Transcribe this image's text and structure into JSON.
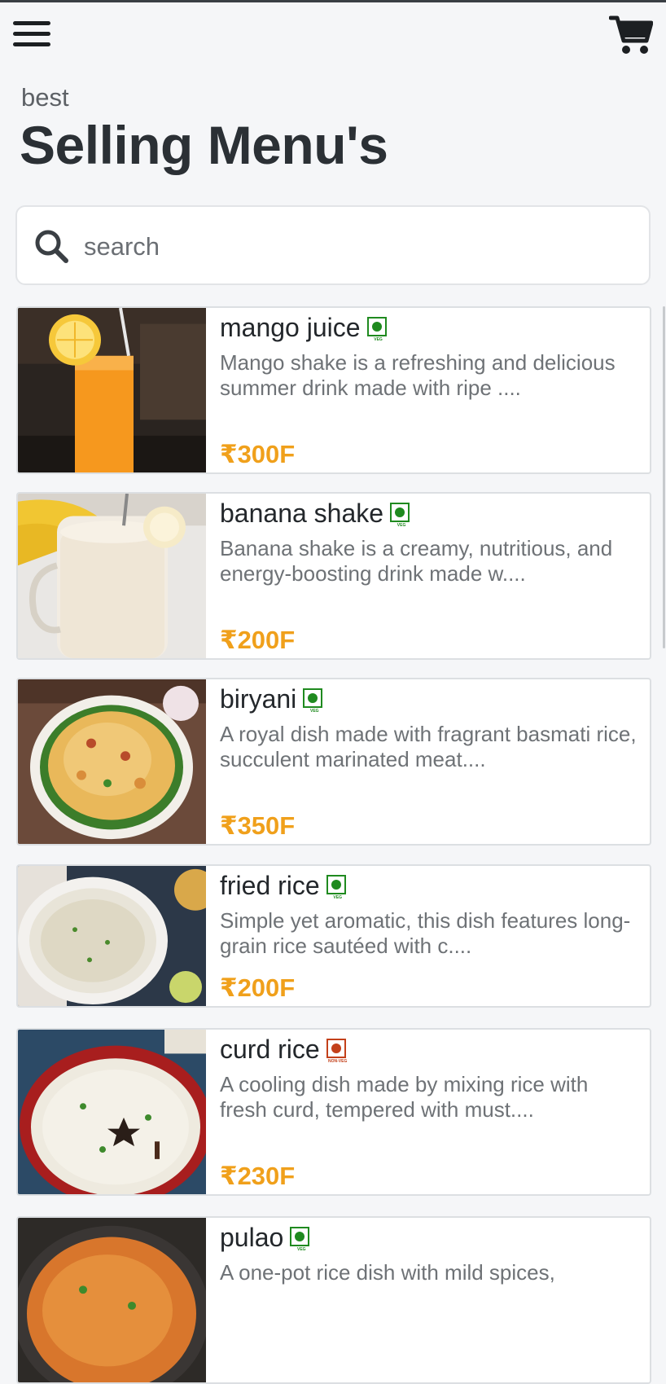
{
  "header": {
    "menu_icon": "hamburger-menu-icon",
    "cart_icon": "shopping-cart-icon",
    "subtitle": "best",
    "title": "Selling Menu's"
  },
  "search": {
    "icon": "search-icon",
    "placeholder": "search",
    "value": ""
  },
  "colors": {
    "accent_price": "#f0a01b",
    "veg": "#1f8a1f",
    "non_veg": "#c3401a",
    "text_dark": "#2b3035"
  },
  "menu_items": [
    {
      "name": "mango juice",
      "badge": "VEG",
      "description": "Mango shake is a refreshing and delicious summer drink made with ripe ....",
      "price": "₹300F"
    },
    {
      "name": "banana shake",
      "badge": "VEG",
      "description": "Banana shake is a creamy, nutritious, and energy-boosting drink made w....",
      "price": "₹200F"
    },
    {
      "name": "biryani",
      "badge": "VEG",
      "description": "A royal dish made with fragrant basmati rice, succulent marinated meat....",
      "price": "₹350F"
    },
    {
      "name": "fried rice",
      "badge": "VEG",
      "description": "Simple yet aromatic, this dish features long-grain rice sautéed with c....",
      "price": "₹200F"
    },
    {
      "name": "curd rice",
      "badge": "NON-VEG",
      "description": "A cooling dish made by mixing rice with fresh curd, tempered with must....",
      "price": "₹230F"
    },
    {
      "name": "pulao",
      "badge": "VEG",
      "description": "A one-pot rice dish with mild spices,",
      "price": ""
    }
  ]
}
